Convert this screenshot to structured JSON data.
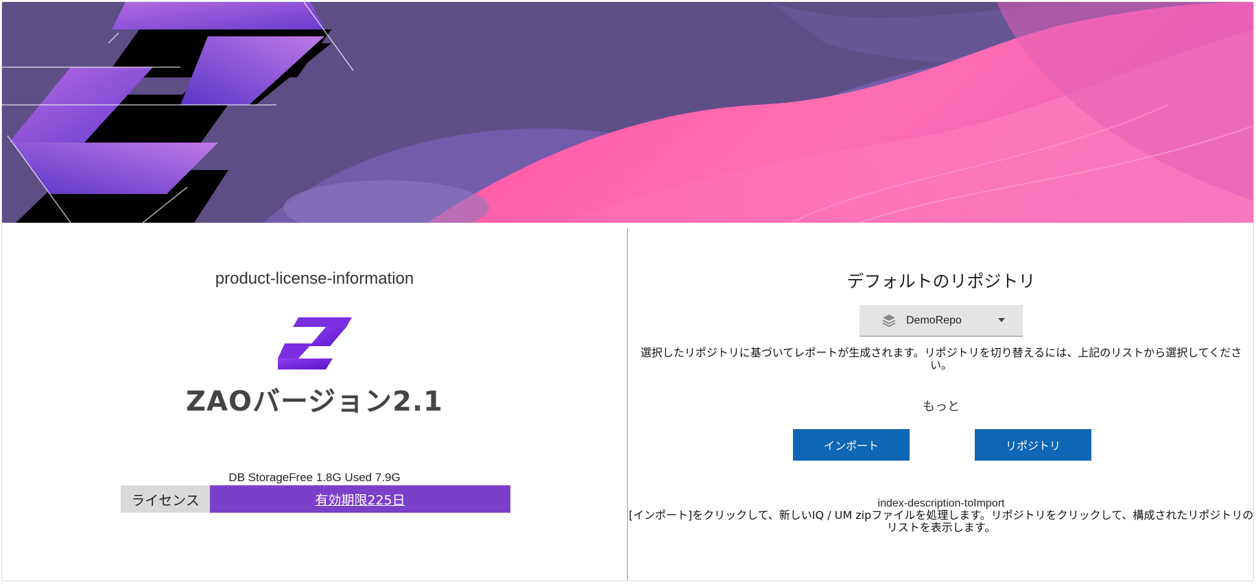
{
  "left_panel": {
    "title": "product-license-information",
    "version": "ZAOバージョン2.1",
    "storage": "DB StorageFree 1.8G Used 7.9G",
    "license_label": "ライセンス",
    "license_status": "有効期限225日"
  },
  "right_panel": {
    "title": "デフォルトのリポジトリ",
    "repo_select": {
      "value": "DemoRepo",
      "icon": "layers-icon"
    },
    "description": "選択したリポジトリに基づいてレポートが生成されます。リポジトリを切り替えるには、上記のリストから選択してください。",
    "more_label": "もっと",
    "import_button": "インポート",
    "repository_button": "リポジトリ",
    "footer_title": "index-description-toImport",
    "footer_description": "[インポート]をクリックして、新しいIQ / UM zipファイルを処理します。リポジトリをクリックして、構成されたリポジトリのリストを表示します。"
  },
  "colors": {
    "license_bar": "#7b3fc9",
    "button": "#0f66b5",
    "banner_base": "#5e4e86",
    "banner_pink": "#ff5aa8"
  }
}
